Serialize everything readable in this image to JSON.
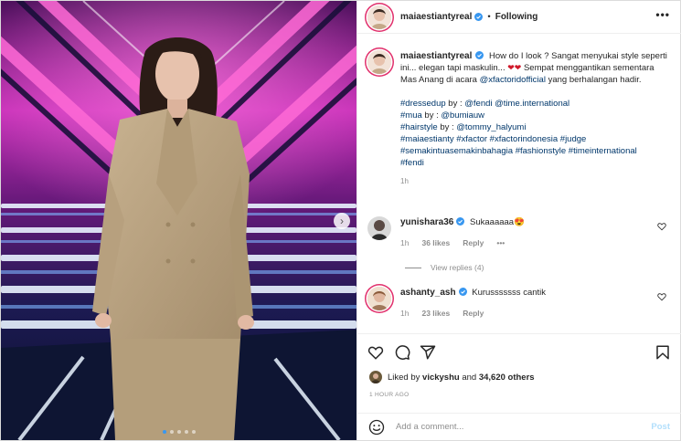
{
  "author": {
    "username": "maiaestiantyreal",
    "separator": "•",
    "follow_status": "Following"
  },
  "caption": {
    "line1": "How do I look ? Sangat menyukai style seperti ini... elegan tapi maskulin...",
    "hearts": "❤❤",
    "line2": "Sempat menggantikan sementara Mas Anang di acara",
    "mention_xf": "@xfactoridofficial",
    "line3": "yang berhalangan hadir.",
    "dressed_tag": "#dressedup",
    "dressed_by": "by :",
    "dressed_mentions": "@fendi @time.international",
    "mua_tag": "#mua",
    "mua_by": "by :",
    "mua_mention": "@bumiauw",
    "hair_tag": "#hairstyle",
    "hair_by": "by :",
    "hair_mention": "@tommy_halyumi",
    "tags1": "#maiaestianty #xfactor #xfactorindonesia #judge",
    "tags2": "#semakintuasemakinbahagia #fashionstyle #timeinternational",
    "tags3": "#fendi",
    "time": "1h"
  },
  "comments": [
    {
      "username": "yunishara36",
      "text": "Sukaaaaaa",
      "emoji": "😍",
      "time": "1h",
      "likes": "36 likes",
      "reply": "Reply",
      "more": "•••",
      "view_replies": "View replies (4)"
    },
    {
      "username": "ashanty_ash",
      "text": "Kurusssssss cantik",
      "time": "1h",
      "likes": "23 likes",
      "reply": "Reply"
    }
  ],
  "likes": {
    "prefix": "Liked by",
    "user": "vickyshu",
    "and": "and",
    "others": "34,620 others"
  },
  "time_ago": "1 HOUR AGO",
  "add_comment": {
    "placeholder": "Add a comment...",
    "post_label": "Post"
  },
  "carousel": {
    "next_icon": "›",
    "total": 5,
    "active_index": 0
  },
  "icons": [
    "more-icon",
    "verified-icon",
    "heart-icon",
    "comment-icon",
    "share-icon",
    "bookmark-icon",
    "emoji-icon",
    "carousel-next-icon"
  ],
  "colors": {
    "verified": "#3897f0",
    "link": "#00376b",
    "muted": "#8e8e8e",
    "post_disabled": "#b2dffc",
    "heart": "#d0182a"
  }
}
